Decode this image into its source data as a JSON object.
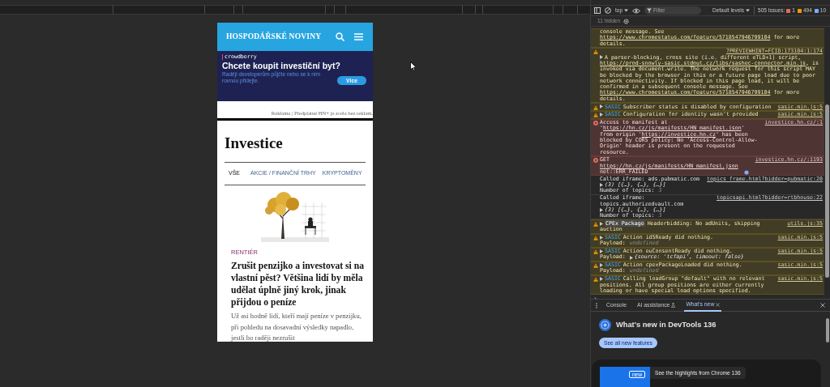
{
  "mobile_page": {
    "site_name": "HOSPODÁŘSKÉ NOVINY",
    "ad": {
      "brand": "crowdberry",
      "headline": "Chcete koupit investiční byt?",
      "text": "Raději developerům půjčte nebo se k nim rovnou přidejte.",
      "button": "Více"
    },
    "ad_notice": "Reklama | Předplatné HN+ je zcela bez reklam.",
    "section_title": "Investice",
    "tabs": [
      {
        "label": "VŠE",
        "selected": true
      },
      {
        "label": "AKCIE / FINANČNÍ TRHY",
        "selected": false
      },
      {
        "label": "KRYPTOMĚNY",
        "selected": false
      }
    ],
    "article": {
      "category": "RENTIÉR",
      "headline": "Zrušit penzijko a investovat si na vlastní pěst? Většina lidí by měla udělat úplně jiný krok, jinak přijdou o peníze",
      "perex": "Už asi hodně lidí, kteří mají peníze v penzijku, při pohledu na dosavadní výsledky napadlo, jestli ho raději nezrušit"
    }
  },
  "devtools": {
    "toolbar": {
      "context": "top",
      "filter_placeholder": "Filter",
      "levels": "Default levels",
      "issues_label": "505 Issues:",
      "issue_counts": [
        {
          "kind": "error",
          "count": "1"
        },
        {
          "kind": "warning",
          "count": "494"
        },
        {
          "kind": "info",
          "count": "10"
        }
      ]
    },
    "hidden_count": "11 hidden",
    "messages": [
      {
        "kind": "warning",
        "continued": true,
        "expandable": false,
        "parts": [
          {
            "text": "console message. See "
          },
          {
            "link": "https://www.chromestatus.com/feature/5718547946799104"
          },
          {
            "text": " for more details."
          }
        ]
      },
      {
        "kind": "warning",
        "continued": false,
        "expandable": true,
        "source": "?PREVIEWHINT=FCID:173104:1:174",
        "parts": [
          {
            "text": "A parser-blocking, cross site (i.e. different eTLD+1) script, "
          },
          {
            "link": "https://prod-snowly-sasic.stdout.cz/libs/sashec-connector.min.js"
          },
          {
            "text": ", is invoked via document.write. The network request for this script MAY be blocked by the browser in this or a future page load due to poor network connectivity. If blocked in this page load, it will be confirmed in a subsequent console message. See "
          },
          {
            "link": "https://www.chromestatus.com/feature/5718547946799104"
          },
          {
            "text": " for more details."
          }
        ]
      },
      {
        "kind": "warning",
        "continued": false,
        "expandable": true,
        "badge": "SASIC",
        "source": "sasic.min.js:5",
        "parts": [
          {
            "text": "Subscriber status is disabled by configuration"
          }
        ]
      },
      {
        "kind": "warning",
        "continued": false,
        "expandable": true,
        "badge": "SASIC",
        "source": "sasic.min.js:5",
        "parts": [
          {
            "text": "Configuration for identity wasn't provided"
          }
        ]
      },
      {
        "kind": "error",
        "continued": false,
        "expandable": false,
        "source": "investice.hn.cz/:1",
        "parts": [
          {
            "text": "Access to manifest at '"
          },
          {
            "link": "https://hn.cz/js/manifests/HN_manifest.json"
          },
          {
            "text": "' from origin '"
          },
          {
            "link": "https://investice.hn.cz"
          },
          {
            "text": "' has been blocked by CORS policy: No 'Access-Control-Allow-Origin' header is present on the requested resource."
          }
        ]
      },
      {
        "kind": "error",
        "continued": false,
        "expandable": false,
        "network": true,
        "source": "investice.hn.cz/:1193",
        "parts": [
          {
            "text": "GET "
          },
          {
            "link": "https://hn.cz/js/manifests/HN_manifest.json"
          },
          {
            "text": " net::ERR_FAILED"
          }
        ]
      },
      {
        "kind": "info",
        "continued": false,
        "expandable": false,
        "source": "topics_frame.html?bidder=pubmatic:20",
        "parts": [
          {
            "text": "Called iframe: ads.pubmatic.com"
          }
        ],
        "lines": [
          {
            "expandable": true,
            "value": "(3) [{…}, {…}, {…}]"
          },
          {
            "expandable": false,
            "label": "Number of topics:",
            "value": "3"
          }
        ]
      },
      {
        "kind": "info",
        "continued": false,
        "expandable": false,
        "source": "topicsapi.html?bidder=rtbhouse:22",
        "parts": [
          {
            "text": "Called iframe: topics.authorizedvault.com"
          }
        ],
        "lines": [
          {
            "expandable": true,
            "value": "(3) [{…}, {…}, {…}]"
          },
          {
            "expandable": false,
            "label": "Number of topics:",
            "value": "3"
          }
        ]
      },
      {
        "kind": "warning",
        "continued": false,
        "expandable": true,
        "badge": "CPEx Package",
        "source": "utils.js:35",
        "parts": [
          {
            "text": "Headerbidding: No adUnits, skipping auction"
          }
        ]
      },
      {
        "kind": "warning",
        "continued": false,
        "expandable": true,
        "badge": "SASIC",
        "source": "sasic.min.js:5",
        "parts": [
          {
            "text": "Action id5Ready did nothing."
          }
        ],
        "lines": [
          {
            "expandable": false,
            "label": "Payload:",
            "value": "undefined"
          }
        ]
      },
      {
        "kind": "warning",
        "continued": false,
        "expandable": true,
        "badge": "SASIC",
        "source": "sasic.min.js:5",
        "parts": [
          {
            "text": "Action euConsentReady did nothing."
          }
        ],
        "lines": [
          {
            "expandable": true,
            "label": "Payload:",
            "value": "{source: 'tcfapi', timeout: false}"
          }
        ]
      },
      {
        "kind": "warning",
        "continued": false,
        "expandable": true,
        "badge": "SASIC",
        "source": "sasic.min.js:5",
        "parts": [
          {
            "text": "Action cpexPackageLoaded did nothing."
          }
        ],
        "lines": [
          {
            "expandable": false,
            "label": "Payload:",
            "value": "undefined"
          }
        ]
      },
      {
        "kind": "warning",
        "continued": false,
        "expandable": true,
        "badge": "SASIC",
        "source": "sasic.min.js:5",
        "parts": [
          {
            "text": "Calling loadGroup \"default\" with no relevant positions. All group positions are either currently loading or have special load options specified."
          }
        ]
      }
    ],
    "drawer": {
      "tabs": [
        {
          "label": "Console",
          "selected": false,
          "closable": false,
          "kind": "plain"
        },
        {
          "label": "AI assistance",
          "selected": false,
          "closable": false,
          "kind": "flask"
        },
        {
          "label": "What's new",
          "selected": true,
          "closable": true,
          "kind": "plain"
        }
      ],
      "title": "What's new in DevTools 136",
      "button": "See all new features",
      "badge": "new",
      "highlight": "See the highlights from Chrome 136"
    }
  }
}
